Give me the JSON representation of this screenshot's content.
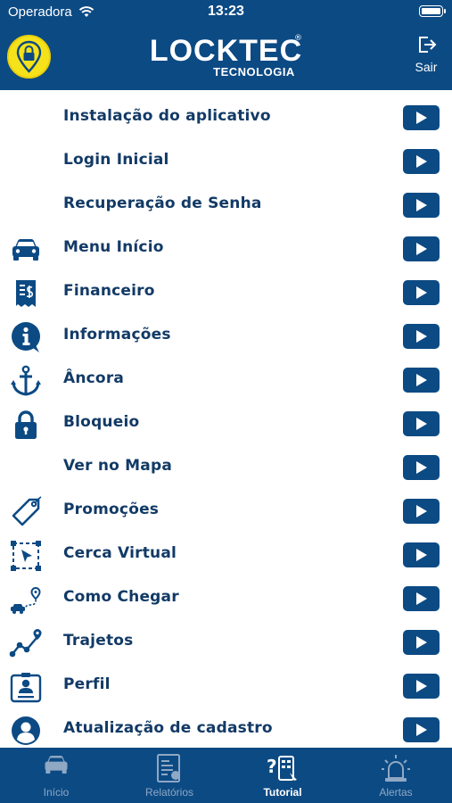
{
  "status_bar": {
    "carrier": "Operadora",
    "time": "13:23"
  },
  "header": {
    "logo_main": "LOCKTEC",
    "logo_sub": "TECNOLOGIA",
    "logo_registered": "®",
    "exit_label": "Sair"
  },
  "tutorials": [
    {
      "label": "Instalação do aplicativo",
      "icon": "none"
    },
    {
      "label": "Login Inicial",
      "icon": "none"
    },
    {
      "label": "Recuperação de Senha",
      "icon": "none"
    },
    {
      "label": "Menu Início",
      "icon": "car-icon"
    },
    {
      "label": "Financeiro",
      "icon": "receipt-icon"
    },
    {
      "label": "Informações",
      "icon": "info-icon"
    },
    {
      "label": "Âncora",
      "icon": "anchor-icon"
    },
    {
      "label": "Bloqueio",
      "icon": "lock-icon"
    },
    {
      "label": "Ver no Mapa",
      "icon": "none"
    },
    {
      "label": "Promoções",
      "icon": "tag-icon"
    },
    {
      "label": "Cerca Virtual",
      "icon": "geofence-icon"
    },
    {
      "label": "Como Chegar",
      "icon": "route-car-icon"
    },
    {
      "label": "Trajetos",
      "icon": "path-icon"
    },
    {
      "label": "Perfil",
      "icon": "profile-card-icon"
    },
    {
      "label": "Atualização de cadastro",
      "icon": "user-circle-icon"
    }
  ],
  "tabs": [
    {
      "label": "Início",
      "icon": "car-icon",
      "active": false
    },
    {
      "label": "Relatórios",
      "icon": "report-icon",
      "active": false
    },
    {
      "label": "Tutorial",
      "icon": "tutorial-icon",
      "active": true
    },
    {
      "label": "Alertas",
      "icon": "alarm-icon",
      "active": false
    }
  ],
  "colors": {
    "primary": "#0c4a84",
    "text": "#123a66",
    "badge": "#f6e21b"
  }
}
